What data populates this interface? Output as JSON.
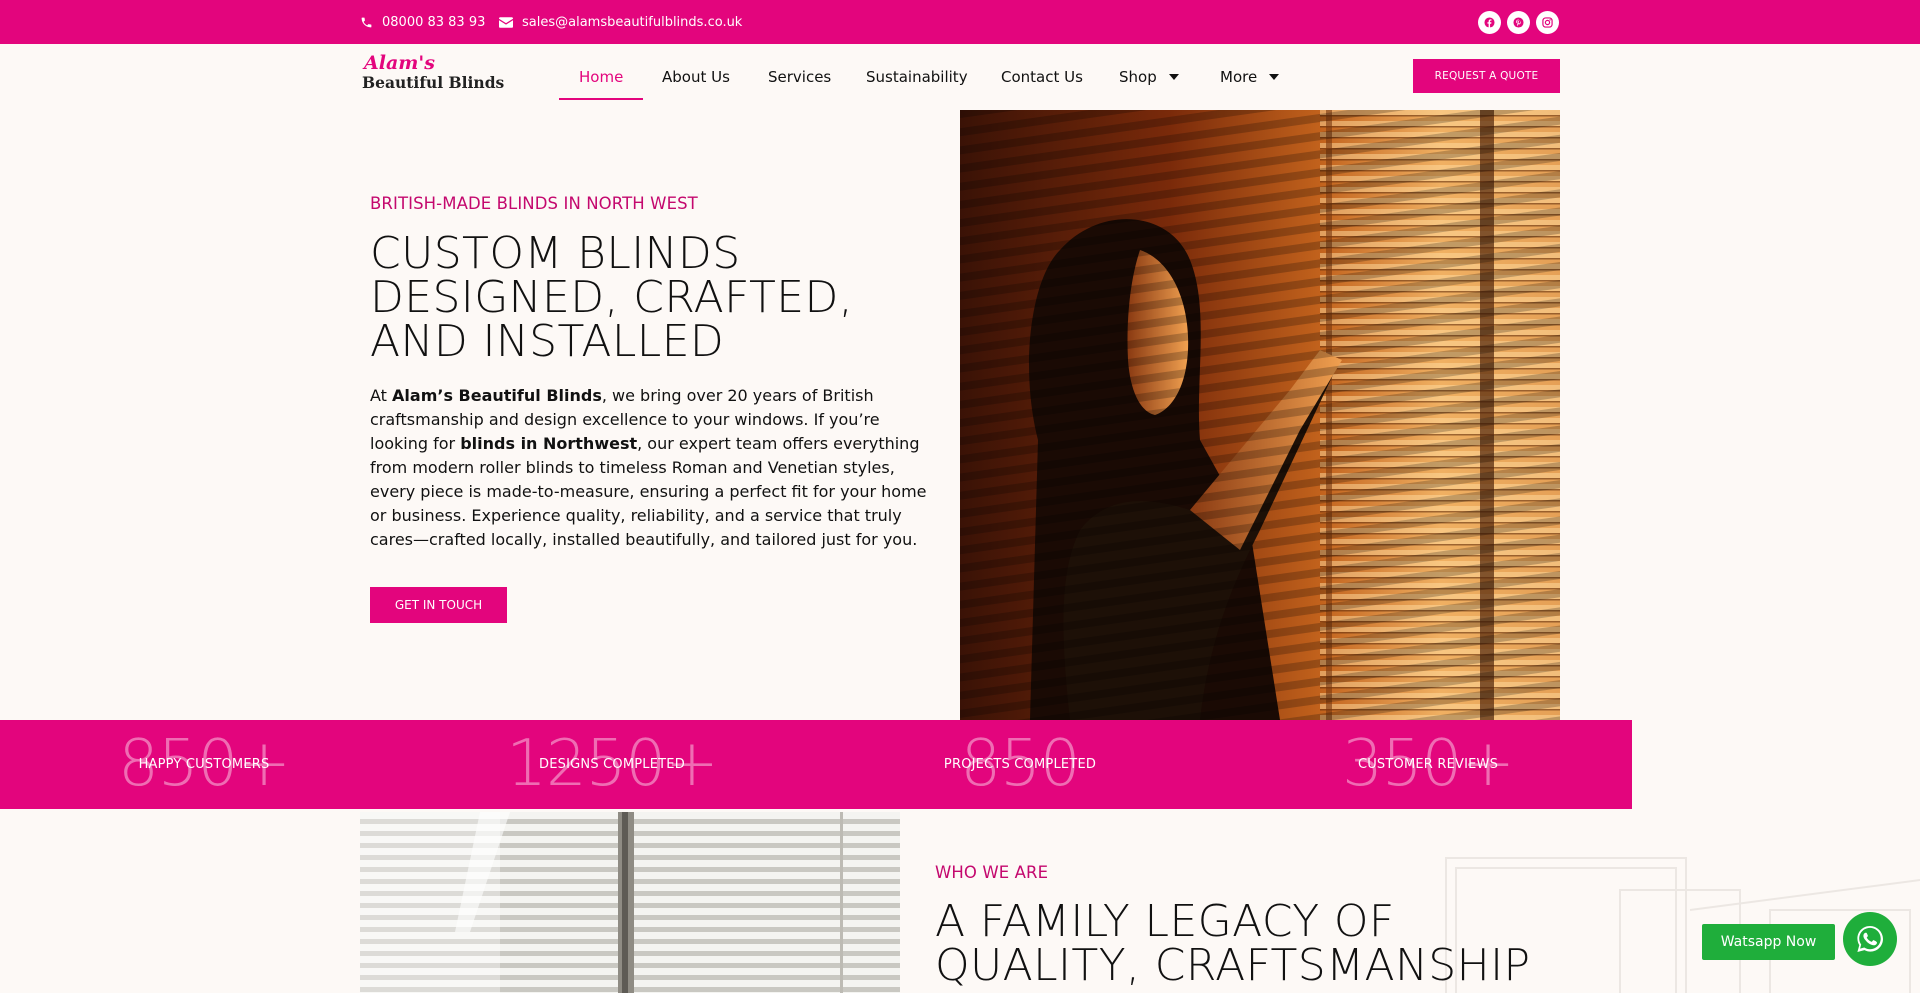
{
  "topbar": {
    "phone": "08000 83 83 93",
    "email": "sales@alamsbeautifulblinds.co.uk",
    "social": [
      "facebook-icon",
      "pinterest-icon",
      "instagram-icon"
    ],
    "color": "#e3057d"
  },
  "header": {
    "logo_line1": "Alam's",
    "logo_line2": "Beautiful Blinds",
    "nav": [
      {
        "label": "Home",
        "active": true
      },
      {
        "label": "About Us"
      },
      {
        "label": "Services"
      },
      {
        "label": "Sustainability"
      },
      {
        "label": "Contact Us"
      },
      {
        "label": "Shop",
        "dropdown": true
      },
      {
        "label": "More",
        "dropdown": true
      }
    ],
    "quote_button": "REQUEST A QUOTE"
  },
  "hero": {
    "eyebrow": "BRITISH-MADE BLINDS IN NORTH WEST",
    "title_lines": [
      "CUSTOM BLINDS",
      "DESIGNED, CRAFTED,",
      "AND INSTALLED"
    ],
    "body": [
      {
        "text": "At "
      },
      {
        "text": "Alam’s Beautiful Blinds",
        "bold": true
      },
      {
        "text": ", we bring over 20 years of British craftsmanship and design excellence to your windows. If you’re looking for "
      },
      {
        "text": "blinds in Northwest",
        "bold": true
      },
      {
        "text": ", our expert team offers everything from modern roller blinds to timeless Roman and Venetian styles, every piece is made-to-measure, ensuring a perfect fit for your home or business. Experience quality, reliability, and a service that truly cares—crafted locally, installed beautifully, and tailored just for you."
      }
    ],
    "cta": "GET IN TOUCH"
  },
  "stats": [
    {
      "number": "850+",
      "label": "HAPPY CUSTOMERS"
    },
    {
      "number": "1250+",
      "label": "DESIGNS COMPLETED"
    },
    {
      "number": "850",
      "label": "PROJECTS COMPLETED"
    },
    {
      "number": "350+",
      "label": "CUSTOMER REVIEWS"
    }
  ],
  "about": {
    "eyebrow": "WHO WE ARE",
    "title_lines": [
      "A FAMILY LEGACY OF",
      "QUALITY, CRAFTSMANSHIP"
    ]
  },
  "whatsapp": {
    "button": "Watsapp Now",
    "color": "#1fae3b"
  }
}
